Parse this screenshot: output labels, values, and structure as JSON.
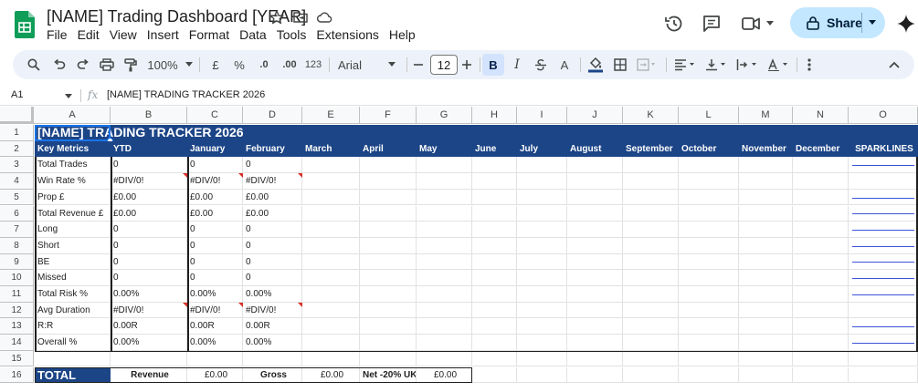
{
  "app": {
    "doc_title": "[NAME] Trading Dashboard [YEAR]",
    "menu": [
      "File",
      "Edit",
      "View",
      "Insert",
      "Format",
      "Data",
      "Tools",
      "Extensions",
      "Help"
    ],
    "share_label": "Share"
  },
  "toolbar": {
    "zoom": "100%",
    "currency": "£",
    "percent": "%",
    "dec_decrease": ".0",
    "dec_increase": ".00",
    "number_format": "123",
    "font": "Arial",
    "font_size": "12",
    "bold": "B",
    "italic": "I",
    "text_color": "A"
  },
  "formula_bar": {
    "cell_ref": "A1",
    "fx": "fx",
    "content": "[NAME] TRADING TRACKER 2026"
  },
  "columns": [
    "A",
    "B",
    "C",
    "D",
    "E",
    "F",
    "G",
    "H",
    "I",
    "J",
    "K",
    "L",
    "M",
    "N",
    "O"
  ],
  "rows": [
    "1",
    "2",
    "3",
    "4",
    "5",
    "6",
    "7",
    "8",
    "9",
    "10",
    "11",
    "12",
    "13",
    "14",
    "15",
    "16"
  ],
  "sheet": {
    "title": "[NAME] TRADING TRACKER 2026",
    "header": [
      "Key Metrics",
      "YTD",
      "January",
      "February",
      "March",
      "April",
      "May",
      "June",
      "July",
      "August",
      "September",
      "October",
      "November",
      "December",
      "SPARKLINES"
    ],
    "metrics": [
      {
        "label": "Total Trades",
        "ytd": "0",
        "jan": "0",
        "feb": "0"
      },
      {
        "label": "Win Rate %",
        "ytd": "#DIV/0!",
        "jan": "#DIV/0!",
        "feb": "#DIV/0!"
      },
      {
        "label": "Prop £",
        "ytd": "£0.00",
        "jan": "£0.00",
        "feb": "£0.00"
      },
      {
        "label": "Total Revenue £",
        "ytd": "£0.00",
        "jan": "£0.00",
        "feb": "£0.00"
      },
      {
        "label": "Long",
        "ytd": "0",
        "jan": "0",
        "feb": "0"
      },
      {
        "label": "Short",
        "ytd": "0",
        "jan": "0",
        "feb": "0"
      },
      {
        "label": "BE",
        "ytd": "0",
        "jan": "0",
        "feb": "0"
      },
      {
        "label": "Missed",
        "ytd": "0",
        "jan": "0",
        "feb": "0"
      },
      {
        "label": "Total Risk %",
        "ytd": "0.00%",
        "jan": "0.00%",
        "feb": "0.00%"
      },
      {
        "label": "Avg Duration",
        "ytd": "#DIV/0!",
        "jan": "#DIV/0!",
        "feb": "#DIV/0!"
      },
      {
        "label": "R:R",
        "ytd": "0.00R",
        "jan": "0.00R",
        "feb": "0.00R"
      },
      {
        "label": "Overall %",
        "ytd": "0.00%",
        "jan": "0.00%",
        "feb": "0.00%"
      }
    ],
    "total": {
      "label": "TOTAL",
      "revenue_label": "Revenue",
      "revenue_value": "£0.00",
      "gross_label": "Gross",
      "gross_value": "£0.00",
      "net_label": "Net -20% UK",
      "net_value": "£0.00"
    }
  }
}
